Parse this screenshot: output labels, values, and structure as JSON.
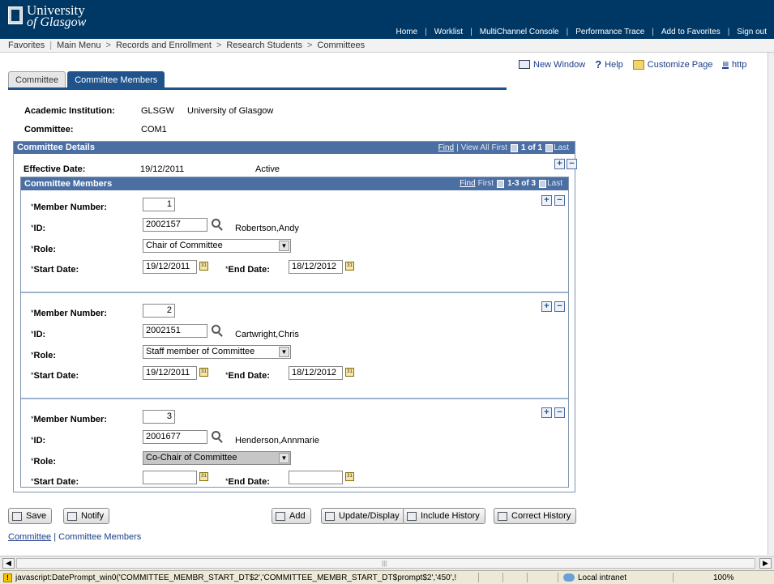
{
  "brand": {
    "line1": "University",
    "line2": "of Glasgow"
  },
  "topnav": [
    "Home",
    "Worklist",
    "MultiChannel Console",
    "Performance Trace",
    "Add to Favorites",
    "Sign out"
  ],
  "breadcrumb": {
    "favorites": "Favorites",
    "items": [
      "Main Menu",
      "Records and Enrollment",
      "Research Students",
      "Committees"
    ],
    "separator": ">"
  },
  "pagelinks": {
    "new_window": "New Window",
    "help": "Help",
    "customize": "Customize Page",
    "http": "http"
  },
  "tabs": [
    {
      "label": "Committee",
      "active": false
    },
    {
      "label": "Committee Members",
      "active": true
    }
  ],
  "info": {
    "institution_label": "Academic Institution:",
    "institution_code": "GLSGW",
    "institution_name": "University of Glasgow",
    "committee_label": "Committee:",
    "committee_value": "COM1"
  },
  "details": {
    "title": "Committee Details",
    "find": "Find",
    "view_all": "View All",
    "first": "First",
    "count": "1 of 1",
    "last": "Last",
    "effective_label": "Effective Date:",
    "effective_value": "19/12/2011",
    "status": "Active"
  },
  "members": {
    "title": "Committee Members",
    "find": "Find",
    "first": "First",
    "count": "1-3 of 3",
    "last": "Last",
    "labels": {
      "member_number": "Member Number:",
      "id": "ID:",
      "role": "Role:",
      "start_date": "Start Date:",
      "end_date": "End Date:",
      "required": "*"
    },
    "rows": [
      {
        "number": "1",
        "id": "2002157",
        "name": "Robertson,Andy",
        "role": "Chair of Committee",
        "start": "19/12/2011",
        "end": "18/12/2012"
      },
      {
        "number": "2",
        "id": "2002151",
        "name": "Cartwright,Chris",
        "role": "Staff member of Committee",
        "start": "19/12/2011",
        "end": "18/12/2012"
      },
      {
        "number": "3",
        "id": "2001677",
        "name": "Henderson,Annmarie",
        "role": "Co-Chair of Committee",
        "start": "",
        "end": ""
      }
    ]
  },
  "buttons": {
    "save": "Save",
    "notify": "Notify",
    "add": "Add",
    "update": "Update/Display",
    "include_history": "Include History",
    "correct_history": "Correct History"
  },
  "footer": {
    "link1": "Committee",
    "sep": " | ",
    "link2": "Committee Members"
  },
  "status": {
    "message": "javascript:DatePrompt_win0('COMMITTEE_MEMBR_START_DT$2','COMMITTEE_MEMBR_START_DT$prompt$2','450',!",
    "zone": "Local intranet",
    "zoom": "100%"
  },
  "colors": {
    "header_bg": "#003865",
    "tab_active": "#20538b",
    "section_hdr": "#4b6fa3"
  }
}
